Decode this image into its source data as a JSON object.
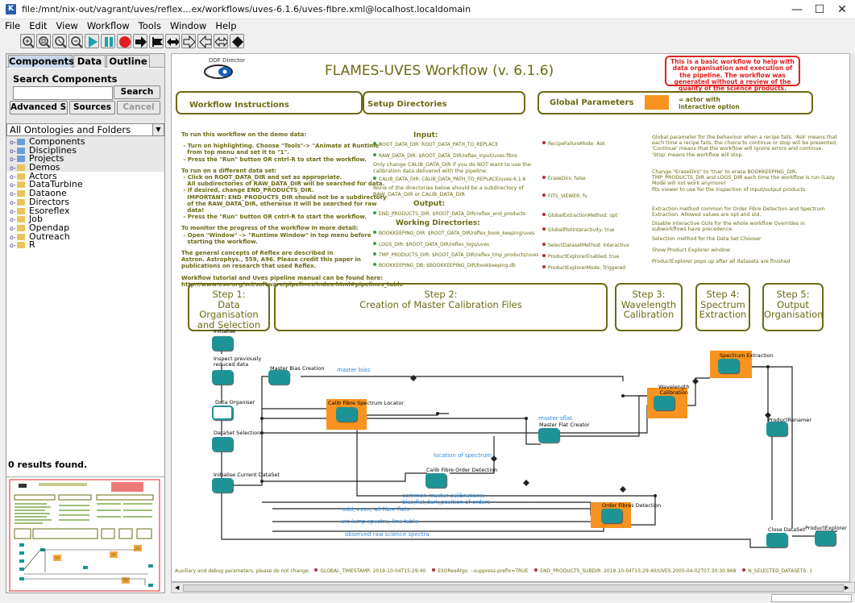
{
  "window": {
    "title": "file:/mnt/nix-out/vagrant/uves/reflex…ex/workflows/uves-6.1.6/uves-fibre.xml@localhost.localdomain",
    "minimize": "—",
    "maximize": "☐",
    "close": "✕"
  },
  "menu": [
    "File",
    "Edit",
    "View",
    "Workflow",
    "Tools",
    "Window",
    "Help"
  ],
  "toolbar": [
    "zoom-in-icon",
    "zoom-reset-icon",
    "zoom-fit-icon",
    "zoom-out-icon",
    "run-icon",
    "pause-icon",
    "stop-icon",
    "step-icon",
    "stop-at-icon",
    "toggle-icon",
    "animate-icon",
    "listen-icon",
    "graph-icon",
    "diamond-icon"
  ],
  "left_panel": {
    "tabs": [
      "Components",
      "Data",
      "Outline"
    ],
    "search_label": "Search Components",
    "search_value": "",
    "search_button": "Search",
    "advanced_button": "Advanced S...",
    "sources_button": "Sources",
    "cancel_button": "Cancel",
    "ontology_select": "All Ontologies and Folders",
    "tree": [
      {
        "label": "Components",
        "kind": "b"
      },
      {
        "label": "Disciplines",
        "kind": "b"
      },
      {
        "label": "Projects",
        "kind": "b"
      },
      {
        "label": "Demos",
        "kind": "y"
      },
      {
        "label": "Actors",
        "kind": "y"
      },
      {
        "label": "DataTurbine",
        "kind": "y"
      },
      {
        "label": "Dataone",
        "kind": "y"
      },
      {
        "label": "Directors",
        "kind": "y"
      },
      {
        "label": "Esoreflex",
        "kind": "y"
      },
      {
        "label": "Job",
        "kind": "y"
      },
      {
        "label": "Opendap",
        "kind": "y"
      },
      {
        "label": "Outreach",
        "kind": "y"
      },
      {
        "label": "R",
        "kind": "y"
      }
    ],
    "results": "0 results found."
  },
  "canvas": {
    "director_label": "DDF Director",
    "title": "FLAMES-UVES Workflow (v. 6.1.6)",
    "note_box": "This is a basic workflow to help with data organisation and execution of the pipeline. The workflow was generated without a review of the quality of the science products.",
    "instructions_btn": "Workflow Instructions",
    "setup_btn": "Setup Directories",
    "global_btn": "Global Parameters",
    "actor_note": "= actor with interactive option",
    "instructions_text": [
      {
        "b": true,
        "t": "To run this workflow on the demo data:"
      },
      {
        "b": false,
        "t": ""
      },
      {
        "b": true,
        "t": " - Turn on highlighting. Choose \"Tools\"-> \"Animate at Runtime\""
      },
      {
        "b": true,
        "t": "   from top menu and set it to \"1\"."
      },
      {
        "b": true,
        "t": " - Press the \"Run\" button OR cntrl-R to start the workflow."
      },
      {
        "b": false,
        "t": ""
      },
      {
        "b": true,
        "t": "To run on a different data set:"
      },
      {
        "b": true,
        "t": " - Click on ROOT_DATA_DIR and set as appropriate."
      },
      {
        "b": true,
        "t": "   All subdirectories of RAW_DATA_DIR will be searched for data."
      },
      {
        "b": true,
        "t": " - If desired, change END_PRODUCTS_DIR."
      },
      {
        "b": true,
        "t": "   IMPORTANT: END_PRODUCTS_DIR should not be a subdirectory"
      },
      {
        "b": true,
        "t": "   of the RAW_DATA_DIR, otherwise it will be searched for raw"
      },
      {
        "b": true,
        "t": "   data!"
      },
      {
        "b": true,
        "t": " - Press the \"Run\" button OR cntrl-R to start the workflow."
      },
      {
        "b": false,
        "t": ""
      },
      {
        "b": true,
        "t": "To monitor the progress of the workflow in more detail:"
      },
      {
        "b": true,
        "t": " - Open \"Window\" -> \"Runtime Window\" in top menu before"
      },
      {
        "b": true,
        "t": "   starting the workflow."
      },
      {
        "b": false,
        "t": ""
      },
      {
        "b": true,
        "t": "The general concepts of Reflex are described in"
      },
      {
        "b": true,
        "t": "Astron. Astrophys., 559, A96. Please credit this paper in"
      },
      {
        "b": true,
        "t": "publications on research that used Reflex."
      },
      {
        "b": false,
        "t": ""
      },
      {
        "b": true,
        "t": "Workflow tutorial and Uves pipeline manual can be found here:"
      },
      {
        "b": true,
        "t": "http://www.eso.org/sci/software/pipelines/index.html#pipelines_table"
      }
    ],
    "input_title": "Input:",
    "root_data_dir": "ROOT_DATA_DIR: ROOT_DATA_PATH_TO_REPLACE",
    "raw_data_dir": "RAW_DATA_DIR: $ROOT_DATA_DIR/reflex_input/uves-fibre",
    "calib_note": "Only change CALIB_DATA_DIR if you do NOT want to use the calibration data delivered with the pipeline:",
    "calib_data_dir": "CALIB_DATA_DIR: CALIB_DATA_PATH_TO_REPLACE/uves-6.1.6",
    "subdir_note": "None of the directories below should be a subdirectory of RAW_DATA_DIR or CALIB_DATA_DIR",
    "output_title": "Output:",
    "end_products_dir": "END_PRODUCTS_DIR: $ROOT_DATA_DIR/reflex_end_products",
    "working_title": "Working Directories:",
    "bookkeeping_dir": "BOOKKEEPING_DIR: $ROOT_DATA_DIR/reflex_book_keeping/uves",
    "logs_dir": "LOGS_DIR: $ROOT_DATA_DIR/reflex_logs/uves",
    "tmp_products_dir": "TMP_PRODUCTS_DIR: $ROOT_DATA_DIR/reflex_tmp_products/uves",
    "bookkeeping_db": "BOOKKEEPING_DB: $BOOKKEEPING_DIR/bookkeeping.db",
    "params": [
      {
        "k": "RecipeFailureMode: Ask",
        "d": "Global parameter for the behaviour when a recipe fails. 'Ask' means that each time a recipe fails, the choice to continue or stop will be presented. 'Continue' means that the workflow will ignore errors and continue. 'Stop' means the workflow will stop."
      },
      {
        "k": "EraseDirs: false",
        "d": "Change \"EraseDirs\" to 'true' to erase BOOKKEEPING_DIR, TMP_PRODUCTS_DIR and LOGS_DIR each time the workflow is run (Lazy Mode will not work anymore)"
      },
      {
        "k": "FITS_VIEWER: fv",
        "d": "fits viewer to use for the inspection of input/output products"
      },
      {
        "k": "GlobalExtractionMethod: opt",
        "d": "Extraction method common for Order Fibre Detection and Spectrum Extraction. Allowed values are opt and std."
      },
      {
        "k": "GlobalPlotInteractivity: true",
        "d": "Disable interactive GUIs for the whole workflow Overrides in subworkflows have precedence."
      },
      {
        "k": "SelectDatasetMethod: Interactive",
        "d": "Selection method for the Data Set Chooser"
      },
      {
        "k": "ProductExplorerEnabled: true",
        "d": "Show Product Explorer window"
      },
      {
        "k": "ProductExplorerMode: Triggered",
        "d": "ProductExplorer pops up after all datasets are finished"
      }
    ],
    "steps": [
      "Step 1:\nData Organisation\nand Selection",
      "Step 2:\nCreation of Master Calibration Files",
      "Step 3:\nWavelength\nCalibration",
      "Step 4:\nSpectrum\nExtraction",
      "Step 5:\nOutput\nOrganisation"
    ],
    "actors": {
      "initialise": "Initialise",
      "inspect": "Inspect previously\nreduced data",
      "data_organiser": "Data Organiser",
      "dataset_selection": "DataSet Selection",
      "init_current": "Initialise Current DataSet",
      "master_bias": "Master Bias Creation",
      "calib_locator": "Calib Fibre Spectrum Locator",
      "master_flat": "Master Flat Creator",
      "calib_order": "Calib Fibre Order Detection",
      "wavelength": "Wavelength\nCalibration",
      "spectrum": "Spectrum Extraction",
      "order_fibres": "Order Fibres Detection",
      "product_renamer": "ProductRenamer",
      "close_dataset": "Close DataSet",
      "product_explorer": "ProductExplorer"
    },
    "channel_labels": {
      "master_bias": "master bias",
      "master_sflat": "master sflat",
      "location": "location of spectrum",
      "common": "common master calibrations:\nbias,flat,dark,position of orders",
      "odd_even": "odd, even, all fibre flats",
      "arc": "arc lamp spectra, line table",
      "observed": "observed raw science spectra"
    },
    "aux_note": "Auxiliary and debug parameters, please do not change:",
    "status_params": [
      "GLOBAL_TIMESTAMP: 2019-10-04T15:29:40",
      "ESORexArgs: --suppress-prefix=TRUE",
      "END_PRODUCTS_SUBDIR: 2019-10-04T15:29:40/UVES.2005-04-02T07:30:30.968",
      "N_SELECTED_DATASETS: 1"
    ]
  },
  "colors": {
    "olive": "#6b6b14",
    "teal": "#1e9396",
    "orange": "#f7931e",
    "blue_label": "#2f8be0",
    "red": "#e02020"
  }
}
